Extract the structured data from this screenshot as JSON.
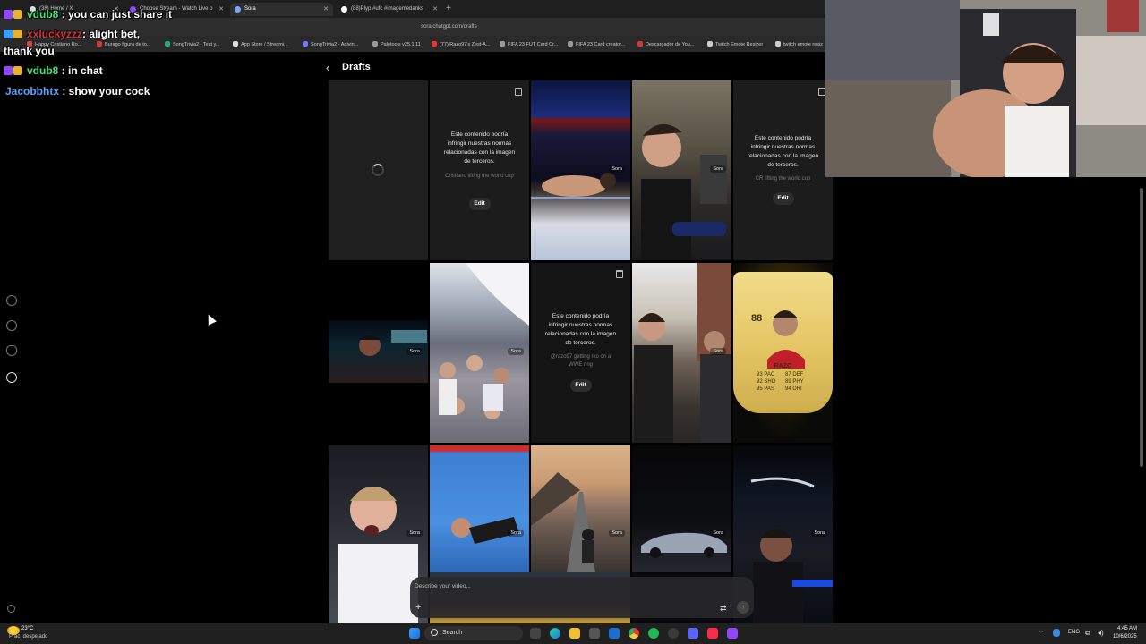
{
  "browser": {
    "tabs": [
      {
        "title": "(38) Home / X",
        "active": false
      },
      {
        "title": "Choose Stream - Watch Live o",
        "active": false
      },
      {
        "title": "Sora",
        "active": true
      },
      {
        "title": "(88)Plyp #ufc #imagemedanks",
        "active": false
      }
    ],
    "url": "sora.chatgpt.com/drafts",
    "bookmarks": [
      "Happy Cristiano Ro...",
      "Burago figura de to...",
      "SongTrivia2 - Test y...",
      "App Store / Streami...",
      "SongTrivia2 - Adivin...",
      "Paletools v25.1.11",
      "(77) Razo97's Zest-A...",
      "FIFA 23 FUT Card Cr...",
      "FIFA 23 Card creator...",
      "Descargador de You...",
      "Twitch Emote Resizer",
      "twitch emote resiz"
    ]
  },
  "chat": [
    {
      "user": "vdub8",
      "message": " : you can just share it",
      "user_color": "#49e07a"
    },
    {
      "user": "xxluckyzzz",
      "message": ": alight bet,",
      "user_color": "#d63a3a"
    },
    {
      "user": "",
      "message": "thank you",
      "user_color": "#ffffff"
    },
    {
      "user": "vdub8",
      "message": " : in chat",
      "user_color": "#49e07a"
    },
    {
      "user": "Jacobbhtx",
      "message": " : show your cock",
      "user_color": "#5aa0ff"
    }
  ],
  "drafts": {
    "title": "Drafts",
    "watermark": "Sora",
    "notice_message": "Este contenido podría infringir nuestras normas relacionadas con la imagen de terceros.",
    "edit_label": "Edit",
    "prompts": {
      "cr_lifting_1": "Cristiano lifting the world cup",
      "cr_lifting_2": "CR lifting the world cup",
      "razo_wwe": "@razo97 getting rko on a WWE ring"
    },
    "card": {
      "rating": "88",
      "name": "RAZO",
      "stats_left": "93 PAC\n92 SHO\n95 PAS",
      "stats_right": "87 DEF\n89 PHY\n94 DRI"
    }
  },
  "composer": {
    "placeholder": "Describe your video..."
  },
  "taskbar": {
    "weather_temp": "23°C",
    "weather_condition": "Prac. despejado",
    "search_label": "Search",
    "lang": "ENG",
    "time": "4:45 AM",
    "date": "10/6/2025"
  },
  "colors": {
    "accent_green": "#49e07a",
    "accent_red": "#d63a3a",
    "accent_blue": "#5aa0ff",
    "panel": "#1c1c1c"
  }
}
